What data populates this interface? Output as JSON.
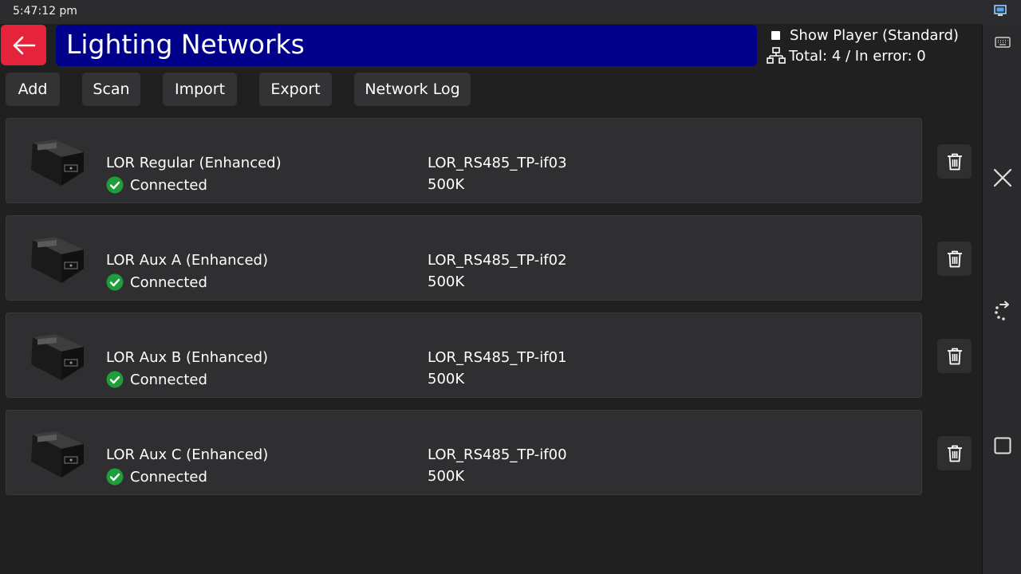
{
  "status_bar": {
    "time": "5:47:12 pm",
    "icons": [
      "cast-icon"
    ]
  },
  "header": {
    "back_icon": "arrow-left-icon",
    "title": "Lighting Networks",
    "show_player_label": "Show Player (Standard)",
    "show_player_checked": false,
    "totals_icon": "network-icon",
    "totals_text": "Total: 4 / In error: 0"
  },
  "toolbar": {
    "add": "Add",
    "scan": "Scan",
    "import": "Import",
    "export": "Export",
    "network_log": "Network Log"
  },
  "networks": [
    {
      "name": "LOR Regular (Enhanced)",
      "status": "Connected",
      "port": "LOR_RS485_TP-if03",
      "speed": "500K"
    },
    {
      "name": "LOR Aux A (Enhanced)",
      "status": "Connected",
      "port": "LOR_RS485_TP-if02",
      "speed": "500K"
    },
    {
      "name": "LOR Aux B (Enhanced)",
      "status": "Connected",
      "port": "LOR_RS485_TP-if01",
      "speed": "500K"
    },
    {
      "name": "LOR Aux C (Enhanced)",
      "status": "Connected",
      "port": "LOR_RS485_TP-if00",
      "speed": "500K"
    }
  ],
  "nav_bar": {
    "icons": [
      "keyboard-icon",
      "close-icon",
      "rotate-icon",
      "square-icon"
    ]
  },
  "colors": {
    "back_button": "#e5243b",
    "title_bar": "#00008b",
    "connected": "#1e9e3a",
    "background": "#202021",
    "card": "#2f2f31"
  }
}
